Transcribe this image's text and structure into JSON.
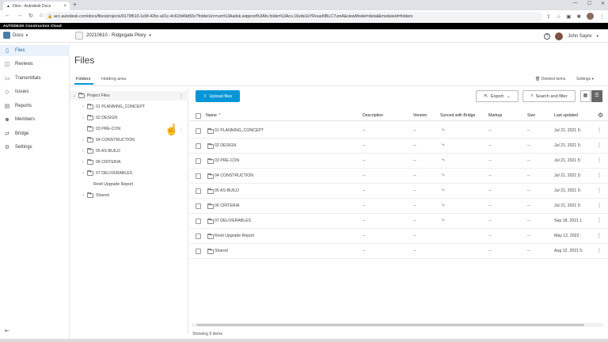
{
  "browser": {
    "tab_title": "Files - Autodesk Docs",
    "tab_close": "×",
    "new_tab": "+",
    "url": "acc.autodesk.com/docs/files/projects/9179f610-1e9f-42bc-a01c-4c61fd49d55c?folderUrn=urn%3Aadsk.wipprod%3Afs.folder%3Aco.16vde1kYRoue8IBLC7umA&viewModel=detail&moduleId=folders"
  },
  "acc_bar": "AUTODESK Construction Cloud",
  "header": {
    "module": "Docs",
    "project": "20210610 - Ridgegate Pkwy",
    "help": "?",
    "user": "John Sayre"
  },
  "nav": {
    "items": [
      {
        "label": "Files",
        "icon": "file-icon"
      },
      {
        "label": "Reviews",
        "icon": "reviews-icon"
      },
      {
        "label": "Transmittals",
        "icon": "transmittals-icon"
      },
      {
        "label": "Issues",
        "icon": "issues-icon"
      },
      {
        "label": "Reports",
        "icon": "reports-icon"
      },
      {
        "label": "Members",
        "icon": "members-icon"
      },
      {
        "label": "Bridge",
        "icon": "bridge-icon"
      },
      {
        "label": "Settings",
        "icon": "gear-icon"
      }
    ]
  },
  "page": {
    "title": "Files",
    "tabs": [
      "Folders",
      "Holding area"
    ],
    "deleted_items": "Deleted items",
    "settings": "Settings"
  },
  "tree": {
    "root": "Project Files",
    "items": [
      {
        "label": "01 PLANNING_CONCEPT",
        "type": "folder",
        "expandable": true
      },
      {
        "label": "02 DESIGN",
        "type": "folder",
        "expandable": true
      },
      {
        "label": "03 PRE-CON",
        "type": "folder",
        "expandable": false
      },
      {
        "label": "04 CONSTRUCTION",
        "type": "folder",
        "expandable": true
      },
      {
        "label": "05 AS-BUILD",
        "type": "folder",
        "expandable": true
      },
      {
        "label": "06 CRITERIA",
        "type": "folder",
        "expandable": true
      },
      {
        "label": "07 DELIVERABLES",
        "type": "folder",
        "expandable": true
      },
      {
        "label": "Revit Upgrade Report",
        "type": "doc",
        "expandable": false
      },
      {
        "label": "Shared",
        "type": "folder",
        "expandable": true
      }
    ]
  },
  "toolbar": {
    "upload": "Upload files",
    "export": "Export",
    "search": "Search and filter"
  },
  "table": {
    "columns": {
      "name": "Name",
      "description": "Description",
      "version": "Version",
      "synced": "Synced with Bridge",
      "markup": "Markup",
      "size": "Size",
      "last_updated": "Last updated"
    },
    "rows": [
      {
        "name": "01 PLANNING_CONCEPT",
        "description": "--",
        "version": "--",
        "markup": "--",
        "size": "--",
        "updated": "Jul 21, 2021 5:"
      },
      {
        "name": "02 DESIGN",
        "description": "--",
        "version": "--",
        "markup": "--",
        "size": "--",
        "updated": "Jul 21, 2021 5:"
      },
      {
        "name": "03 PRE-CON",
        "description": "--",
        "version": "--",
        "markup": "--",
        "size": "--",
        "updated": "Jul 21, 2021 5:"
      },
      {
        "name": "04 CONSTRUCTION",
        "description": "--",
        "version": "--",
        "markup": "--",
        "size": "--",
        "updated": "Jul 21, 2021 5:"
      },
      {
        "name": "05 AS-BUILD",
        "description": "--",
        "version": "--",
        "markup": "--",
        "size": "--",
        "updated": "Jul 21, 2021 5:"
      },
      {
        "name": "06 CRITERIA",
        "description": "--",
        "version": "--",
        "markup": "--",
        "size": "--",
        "updated": "Jul 21, 2021 5:"
      },
      {
        "name": "07 DELIVERABLES",
        "description": "--",
        "version": "--",
        "markup": "--",
        "size": "--",
        "updated": "Sep 18, 2021 1"
      },
      {
        "name": "Revit Upgrade Report",
        "description": "--",
        "version": "--",
        "markup": "--",
        "size": "--",
        "updated": "May 12, 2022 :"
      },
      {
        "name": "Shared",
        "description": "--",
        "version": "--",
        "markup": "--",
        "size": "--",
        "updated": "Aug 12, 2021 5:"
      }
    ]
  },
  "footer": "Showing 9 items",
  "colors": {
    "accent": "#0696d7",
    "active_nav_bg": "#eaf3fb"
  }
}
